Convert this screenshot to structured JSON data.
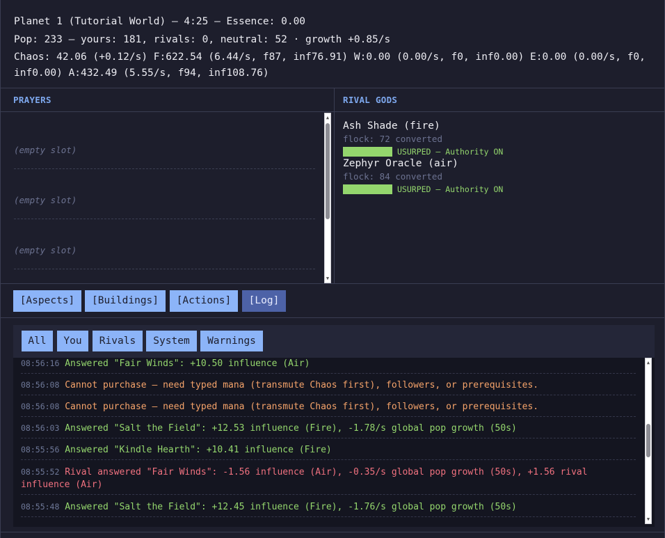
{
  "header": {
    "line1": "Planet 1 (Tutorial World) — 4:25 — Essence: 0.00",
    "line2": "Pop: 233 — yours: 181, rivals: 0, neutral: 52 · growth +0.85/s",
    "line3": "Chaos: 42.06 (+0.12/s) F:622.54 (6.44/s, f87, inf76.91) W:0.00 (0.00/s, f0, inf0.00) E:0.00 (0.00/s, f0, inf0.00) A:432.49 (5.55/s, f94, inf108.76)"
  },
  "prayers": {
    "title": "PRAYERS",
    "slots": [
      "(empty slot)",
      "(empty slot)",
      "(empty slot)"
    ]
  },
  "rivals": {
    "title": "RIVAL GODS",
    "gods": [
      {
        "name": "Ash Shade (fire)",
        "flock": "flock: 72 converted",
        "status": "USURPED — Authority ON",
        "bar_fill": 1.0
      },
      {
        "name": "Zephyr Oracle (air)",
        "flock": "flock: 84 converted",
        "status": "USURPED — Authority ON",
        "bar_fill": 1.0
      }
    ]
  },
  "tabs": [
    "[Aspects]",
    "[Buildings]",
    "[Actions]",
    "[Log]"
  ],
  "active_tab": "[Log]",
  "log": {
    "filters": [
      "All",
      "You",
      "Rivals",
      "System",
      "Warnings"
    ],
    "entries": [
      {
        "time": "08:56:16",
        "text": "Answered \"Fair Winds\": +10.50 influence (Air)",
        "kind": "green"
      },
      {
        "time": "08:56:08",
        "text": "Cannot purchase — need typed mana (transmute Chaos first), followers, or prerequisites.",
        "kind": "orange"
      },
      {
        "time": "08:56:08",
        "text": "Cannot purchase — need typed mana (transmute Chaos first), followers, or prerequisites.",
        "kind": "orange"
      },
      {
        "time": "08:56:03",
        "text": "Answered \"Salt the Field\": +12.53 influence (Fire), -1.78/s global pop growth (50s)",
        "kind": "green"
      },
      {
        "time": "08:55:56",
        "text": "Answered \"Kindle Hearth\": +10.41 influence (Fire)",
        "kind": "green"
      },
      {
        "time": "08:55:52",
        "text": "Rival answered \"Fair Winds\": -1.56 influence (Air), -0.35/s global pop growth (50s), +1.56 rival influence (Air)",
        "kind": "red"
      },
      {
        "time": "08:55:48",
        "text": "Answered \"Salt the Field\": +12.45 influence (Fire), -1.76/s global pop growth (50s)",
        "kind": "green"
      }
    ]
  },
  "colors": {
    "background": "#1d1e2c",
    "accent_title": "#7ea8ee",
    "tab": "#8cb4f8",
    "tab_active": "#4d62a7",
    "ok_green": "#94d66d",
    "warn_orange": "#f5a36a",
    "rival_red": "#f0717f"
  },
  "icons": [
    "scroll-up-arrow-icon",
    "scroll-down-arrow-icon"
  ]
}
